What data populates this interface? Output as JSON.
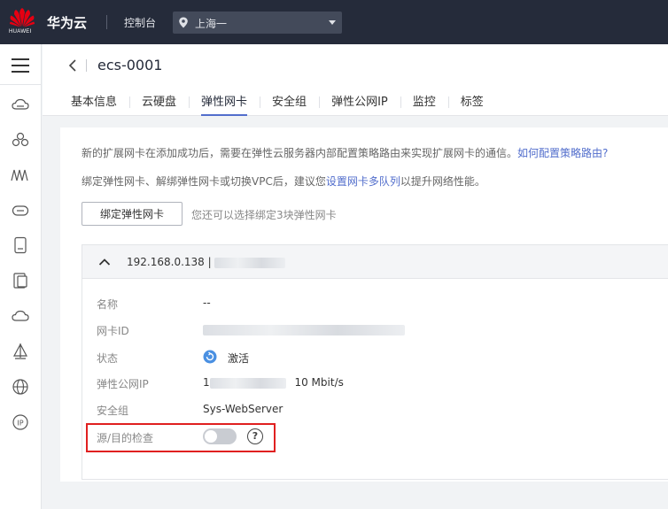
{
  "topbar": {
    "logo_text": "HUAWEI",
    "brand": "华为云",
    "console": "控制台",
    "region": "上海一"
  },
  "page": {
    "title": "ecs-0001"
  },
  "tabs": [
    "基本信息",
    "云硬盘",
    "弹性网卡",
    "安全组",
    "弹性公网IP",
    "监控",
    "标签"
  ],
  "active_tab": "弹性网卡",
  "content": {
    "tip1_text": "新的扩展网卡在添加成功后，需要在弹性云服务器内部配置策略路由来实现扩展网卡的通信。",
    "tip1_link": "如何配置策略路由?",
    "tip2_prefix": "绑定弹性网卡、解绑弹性网卡或切换VPC后，建议您",
    "tip2_link": "设置网卡多队列",
    "tip2_suffix": "以提升网络性能。",
    "bind_button": "绑定弹性网卡",
    "bind_hint": "您还可以选择绑定3块弹性网卡"
  },
  "nic": {
    "ip": "192.168.0.138 |",
    "fields": {
      "name_label": "名称",
      "name_value": "--",
      "id_label": "网卡ID",
      "status_label": "状态",
      "status_value": "激活",
      "eip_label": "弹性公网IP",
      "eip_prefix": "1",
      "eip_bandwidth": "10 Mbit/s",
      "sg_label": "安全组",
      "sg_value": "Sys-WebServer",
      "check_label": "源/目的检查"
    },
    "source_dest_check_enabled": false
  },
  "colors": {
    "topbar": "#252b3a",
    "accent": "#526ecc",
    "highlight": "#e02020",
    "status_active": "#4a90e2"
  }
}
